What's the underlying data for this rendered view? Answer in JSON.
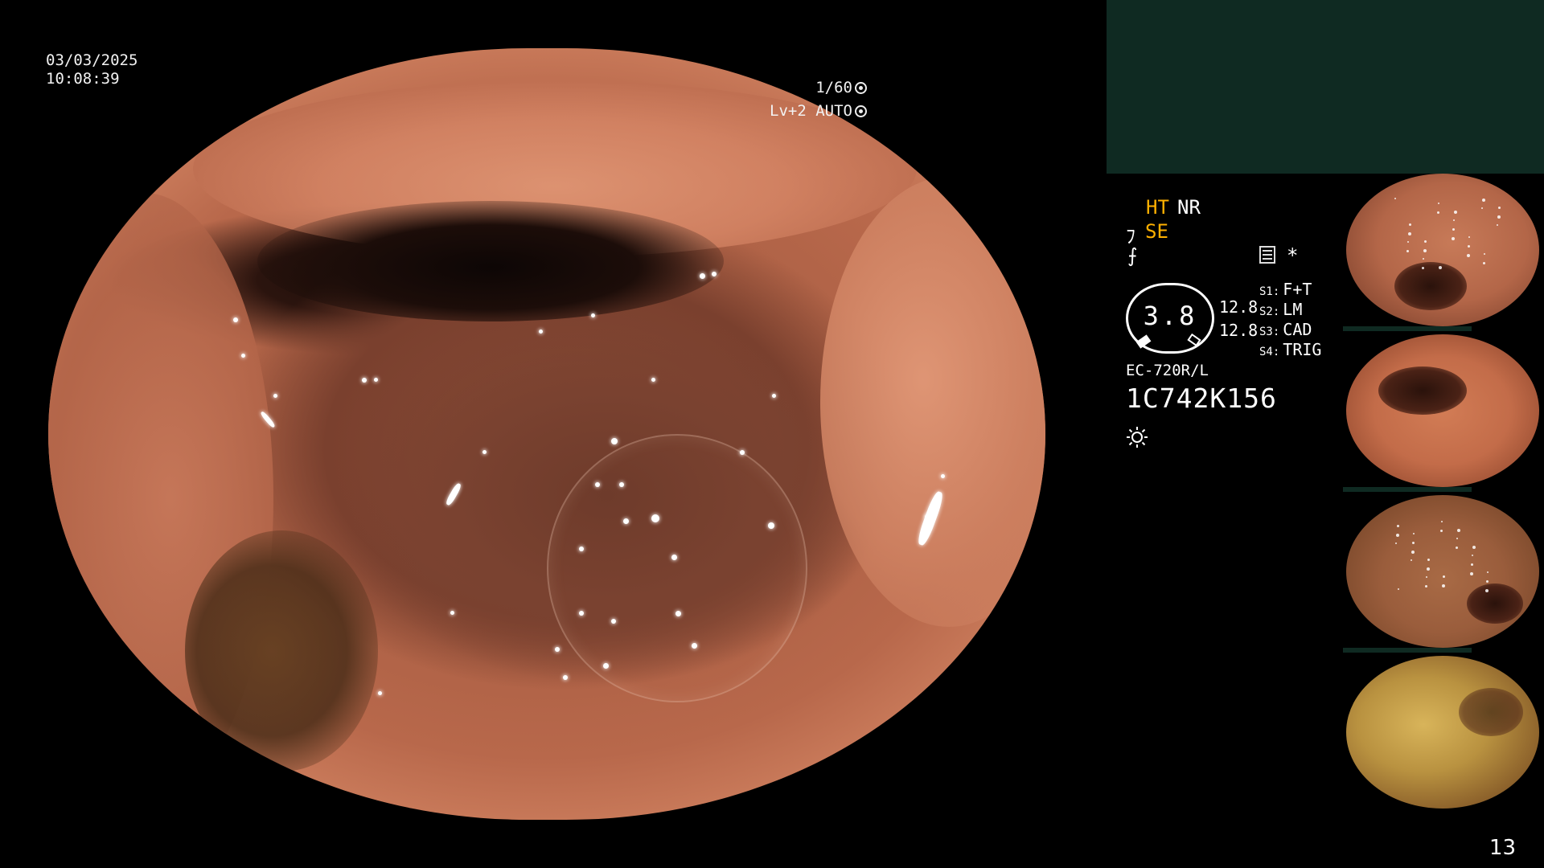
{
  "osd": {
    "date": "03/03/2025",
    "time": "10:08:39",
    "shutter": "1/60",
    "level": "Lv+2",
    "iris": "AUTO"
  },
  "right_panel": {
    "mode_ht": "HT",
    "mode_nr": "NR",
    "mode_se": "SE",
    "edge_icon_glyph": "⨍",
    "star_glyph": "*",
    "gauge_value": "3.8",
    "value_1": "12.8",
    "value_2": "12.8",
    "slots": [
      {
        "key": "S1:",
        "label": "F+T"
      },
      {
        "key": "S2:",
        "label": "LM"
      },
      {
        "key": "S3:",
        "label": "CAD"
      },
      {
        "key": "S4:",
        "label": "TRIG"
      }
    ],
    "scope_model": "EC-720R/L",
    "scope_serial": "1C742K156"
  },
  "thumbnails": [
    {
      "name": "capture-1"
    },
    {
      "name": "capture-2"
    },
    {
      "name": "capture-3"
    },
    {
      "name": "capture-4"
    }
  ],
  "page_number": "13",
  "colors": {
    "background": "#000000",
    "top_panel": "#0f2a22",
    "accent_orange": "#ffb000",
    "text": "#ffffff"
  },
  "icons": [
    "shutter-icon",
    "iris-icon",
    "se-mode-icon",
    "edge-enhance-icon",
    "menu-icon",
    "star-icon",
    "brightness-icon"
  ]
}
